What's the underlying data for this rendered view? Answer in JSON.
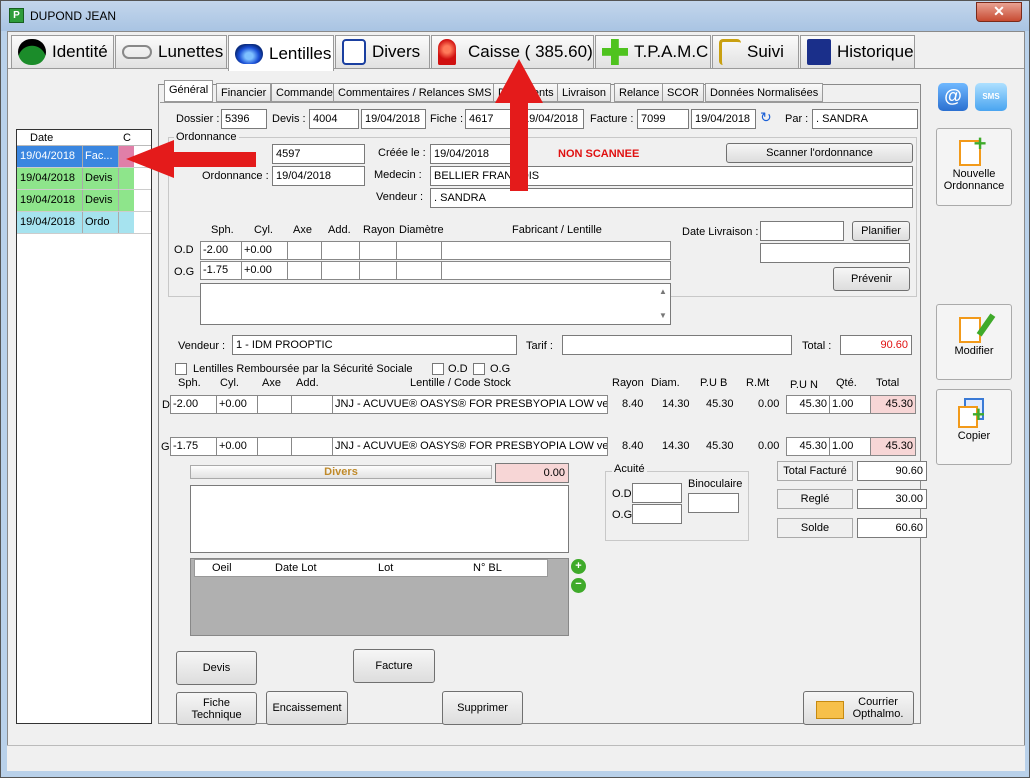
{
  "window": {
    "title": "DUPOND JEAN",
    "close": "✕"
  },
  "main_tabs": [
    {
      "label": "Identité",
      "color": "#1b8c2a"
    },
    {
      "label": "Lunettes",
      "color": "#888888"
    },
    {
      "label": "Lentilles",
      "color": "#1a4fd6"
    },
    {
      "label": "Divers",
      "color": "#1a3fa0"
    },
    {
      "label": "Caisse ( 385.60)",
      "color": "#d01010"
    },
    {
      "label": "T.P.A.M.C",
      "color": "#4fc31f"
    },
    {
      "label": "Suivi",
      "color": "#c9a011"
    },
    {
      "label": "Historique",
      "color": "#1a2f8a"
    }
  ],
  "left_table": {
    "headers": [
      "Date",
      "C"
    ],
    "rows": [
      {
        "date": "19/04/2018",
        "type": "Fac...",
        "color": "#e07fa8",
        "selected": true
      },
      {
        "date": "19/04/2018",
        "type": "Devis",
        "color": "#8ee58b"
      },
      {
        "date": "19/04/2018",
        "type": "Devis",
        "color": "#8ee58b"
      },
      {
        "date": "19/04/2018",
        "type": "Ordo",
        "color": "#a6e3ef"
      }
    ]
  },
  "sub_tabs": [
    "Général",
    "Financier",
    "Commande",
    "Commentaires / Relances SMS",
    "Documents",
    "Livraison",
    "Relance",
    "SCOR",
    "Données Normalisées"
  ],
  "header": {
    "dossier_label": "Dossier :",
    "dossier": "5396",
    "devis_label": "Devis :",
    "devis": "4004",
    "devis_date": "19/04/2018",
    "fiche_label": "Fiche :",
    "fiche": "4617",
    "fiche_date": "19/04/2018",
    "facture_label": "Facture :",
    "facture": "7099",
    "facture_date": "19/04/2018",
    "par_label": "Par :",
    "par": ". SANDRA"
  },
  "ordonnance": {
    "group_label": "Ordonnance",
    "num": "4597",
    "date_label": "Ordonnance :",
    "date": "19/04/2018",
    "creee_label": "Créée le :",
    "creee": "19/04/2018",
    "status": "NON SCANNEE",
    "scan_btn": "Scanner l'ordonnance",
    "medecin_label": "Medecin :",
    "medecin": "BELLIER FRANCOIS",
    "vendeur_label": "Vendeur :",
    "vendeur": ". SANDRA"
  },
  "prescription": {
    "headers": [
      "Sph.",
      "Cyl.",
      "Axe",
      "Add.",
      "Rayon",
      "Diamètre",
      "Fabricant / Lentille"
    ],
    "od_label": "O.D",
    "og_label": "O.G",
    "od": {
      "sph": "-2.00",
      "cyl": "+0.00"
    },
    "og": {
      "sph": "-1.75",
      "cyl": "+0.00"
    },
    "date_livraison_label": "Date Livraison :",
    "planifier": "Planifier",
    "prevenir": "Prévenir"
  },
  "sale": {
    "vendeur_label": "Vendeur :",
    "vendeur": "1 - IDM PROOPTIC",
    "tarif_label": "Tarif :",
    "tarif": "",
    "total_label": "Total :",
    "total": "90.60",
    "rembourse_label": "Lentilles Remboursée par la Sécurité Sociale",
    "od_chk": "O.D",
    "og_chk": "O.G"
  },
  "lens_table": {
    "headers": [
      "Sph.",
      "Cyl.",
      "Axe",
      "Add.",
      "Lentille / Code Stock",
      "Rayon",
      "Diam.",
      "P.U B",
      "R.Mt",
      "P.U N",
      "Qté.",
      "Total"
    ],
    "od": {
      "side": "D",
      "sph": "-2.00",
      "cyl": "+0.00",
      "lens": "JNJ - ACUVUE® OASYS® FOR PRESBYOPIA LOW ve...",
      "rayon": "8.40",
      "diam": "14.30",
      "pub": "45.30",
      "rmt": "0.00",
      "pun": "45.30",
      "qte": "1.00",
      "total": "45.30"
    },
    "og": {
      "side": "G",
      "sph": "-1.75",
      "cyl": "+0.00",
      "lens": "JNJ - ACUVUE® OASYS® FOR PRESBYOPIA LOW ve...",
      "rayon": "8.40",
      "diam": "14.30",
      "pub": "45.30",
      "rmt": "0.00",
      "pun": "45.30",
      "qte": "1.00",
      "total": "45.30"
    }
  },
  "divers": {
    "label": "Divers",
    "value": "0.00"
  },
  "acuite": {
    "label": "Acuité",
    "od": "O.D",
    "og": "O.G",
    "bino": "Binoculaire"
  },
  "totals": {
    "facture_label": "Total Facturé",
    "facture": "90.60",
    "regle_label": "Reglé",
    "regle": "30.00",
    "solde_label": "Solde",
    "solde": "60.60"
  },
  "lot_table": {
    "headers": [
      "Oeil",
      "Date Lot",
      "Lot",
      "N° BL"
    ]
  },
  "buttons": {
    "devis": "Devis",
    "facture": "Facture",
    "fiche": "Fiche Technique",
    "encaissement": "Encaissement",
    "supprimer": "Supprimer",
    "courrier": "Courrier Opthalmo."
  },
  "right_buttons": {
    "at": "@",
    "sms": "SMS",
    "nouvelle": "Nouvelle Ordonnance",
    "modifier": "Modifier",
    "copier": "Copier"
  },
  "colors": {
    "accent_red": "#e01010",
    "arrow_red": "#e41b1b",
    "pink_cell": "#f7d6d6"
  }
}
